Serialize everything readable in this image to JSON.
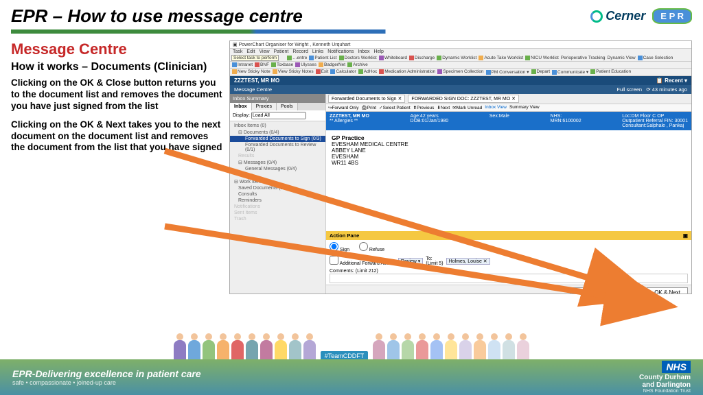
{
  "title": "EPR – How to use message centre",
  "logos": {
    "cerner": "Cerner",
    "epr": "E P R"
  },
  "left": {
    "heading": "Message Centre",
    "sub": "How it works – Documents (Clinician)",
    "p1": "Clicking on the OK & Close button returns you to the document list and removes the document you have just signed from the list",
    "p2": "Clicking on the OK & Next takes you to the  next document on the document list and removes the document from the list that you have signed"
  },
  "app": {
    "window_title": "PowerChart Organiser for Wright , Kenneth Urquhart",
    "tooltip": "Select task to perform",
    "menu": [
      "Task",
      "Edit",
      "View",
      "Patient",
      "Record",
      "Links",
      "Notifications",
      "Inbox",
      "Help"
    ],
    "toolbar1": [
      "…entre",
      "Patient List",
      "Doctors Worklist",
      "Whiteboard",
      "Discharge",
      "Dynamic Worklist",
      "Acute Take Worklist",
      "NICU Worklist",
      "Perioperative Tracking",
      "Dynamic View",
      "Case Selection"
    ],
    "toolbar_links": [
      "Intranet",
      "BNF",
      "Toxbase",
      "Ulysses",
      "BadgerNet",
      "Archive"
    ],
    "toolbar2": [
      "New Sticky Note",
      "View Sticky Notes",
      "Exit",
      "Calculator",
      "AdHoc",
      "Medication Administration",
      "Specimen Collection",
      "PM Conversation ▾",
      "Depart",
      "Communicate ▾",
      "Patient Education"
    ],
    "patient": "ZZZTEST, MR MO",
    "recent_label": "Recent ▾",
    "module": "Message Centre",
    "fullscreen": "Full screen",
    "age_label": "43 minutes ago",
    "sidebar_hdr": "Inbox Summary",
    "tabs": [
      "Inbox",
      "Proxies",
      "Pools"
    ],
    "display_lbl": "Display:",
    "display_val": "Load All",
    "tree": {
      "inbox": "Inbox Items (0)",
      "docs": "Documents (0/4)",
      "fsign": "Forwarded Documents to Sign (0/3)",
      "frev": "Forwarded Documents to Review (0/1)",
      "results": "Results",
      "msgs": "Messages (0/4)",
      "gmsgs": "General Messages (0/4)",
      "orders": "Orders",
      "work": "Work Items (2)",
      "saved": "Saved Documents (2/2)",
      "consults": "Consults",
      "reminders": "Reminders",
      "notif": "Notifications",
      "sent": "Sent Items",
      "trash": "Trash"
    },
    "doctabs": {
      "t1": "Forwarded Documents to Sign  ✕",
      "t2": "FORWARDED SIGN DOC: ZZZTEST, MR MO  ✕"
    },
    "doctools": [
      "Forward Only",
      "Print",
      "Select Patient",
      "Previous",
      "Next",
      "Mark Unread",
      "Inbox View",
      "Summary View"
    ],
    "banner": {
      "name": "ZZZTEST, MR MO",
      "allerg": "** Allergies **",
      "age": "Age:42 years",
      "dob": "DOB:01/Jan/1980",
      "sex": "Sex:Male",
      "nhs": "NHS:",
      "mrn": "MRN:6100002",
      "fin": "Outpatient Referral FIN: 30001",
      "loc": "Loc:DM Floor C OP",
      "cons": "Consultant:Salphale , Pankaj"
    },
    "doc": {
      "h": "GP Practice",
      "l1": "EVESHAM MEDICAL CENTRE",
      "l2": "ABBEY LANE",
      "l3": "EVESHAM",
      "l4": "WR11 4BS"
    },
    "pane": "Action Pane",
    "sign": "Sign",
    "refuse": "Refuse",
    "add_fwd": "Additional Forward Action:",
    "review": "Review ▾",
    "to": "To:",
    "limit5": "(Limit 5)",
    "recipient": "Holmes, Louise ✕",
    "comments": "Comments:",
    "limit212": "(Limit 212)",
    "btn_next": "Next",
    "btn_okclose": "OK & Close",
    "btn_oknext": "OK & Next"
  },
  "team_tag": "#TeamCDDFT",
  "footer": {
    "tag": "EPR-Delivering excellence in patient care",
    "sub": "safe • compassionate • joined-up care",
    "nhs": "NHS",
    "trust1": "County Durham",
    "trust2": "and Darlington",
    "trust3": "NHS Foundation Trust"
  }
}
